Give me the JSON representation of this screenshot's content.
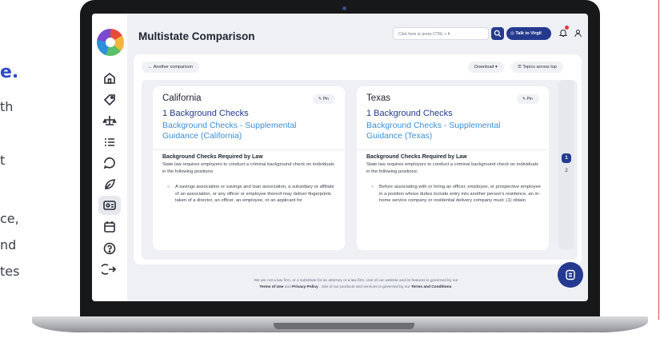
{
  "marketing": {
    "headline_fragment": "e.",
    "lines": [
      "th",
      "t",
      "ce,",
      "nd",
      "tes"
    ]
  },
  "app": {
    "page_title": "Multistate Comparison",
    "search_placeholder": "Click here or press CTRL + K",
    "talk_button_label": "Talk to Virgil"
  },
  "toolbar": {
    "back_label": "← Another comparison",
    "download_label": "Download ▾",
    "topics_label": "Topics across top"
  },
  "cards": [
    {
      "state": "California",
      "pin_label": "Pin",
      "topic": "1 Background Checks",
      "subtopic": "Background Checks - Supplemental Guidance (California)",
      "section_heading": "Background Checks Required by Law",
      "section_text": "State law requires employers to conduct a criminal background check on individuals in the following positions:",
      "bullet": "A savings association or savings and loan association, a subsidiary or affiliate of an association, or any officer or employee thereof may deliver fingerprints taken of a director, an officer, an employee, or an applicant for"
    },
    {
      "state": "Texas",
      "pin_label": "Pin",
      "topic": "1 Background Checks",
      "subtopic": "Background Checks - Supplemental Guidance (Texas)",
      "section_heading": "Background Checks Required by Law",
      "section_text": "State law requires employers to conduct a criminal background check on individuals in the following positions:",
      "bullet": "Before associating with or hiring an officer, employee, or prospective employee in a position whose duties include entry into another person's residence, an in-home service company or residential delivery company must: (1) obtain"
    }
  ],
  "pagination": {
    "current": "1",
    "next": "2"
  },
  "footer": {
    "line1": "We are not a law firm, or a substitute for an attorney or a law firm. Use of our website and its features is governed by our",
    "terms_of_use": "Terms of Use",
    "and1": "and",
    "privacy_policy": "Privacy Policy",
    "line2_mid": ". Use of our products and services is governed by our",
    "terms_conditions": "Terms and Conditions",
    "period": "."
  },
  "colors": {
    "brand_navy": "#253a8f",
    "link_blue": "#3b8fd6",
    "notification_red": "#e03b3b"
  },
  "icons": [
    "home-icon",
    "tag-icon",
    "scale-icon",
    "list-icon",
    "chat-bubble-icon",
    "leaf-icon",
    "id-card-icon",
    "calendar-icon",
    "help-icon",
    "logout-icon",
    "search-icon",
    "virgil-icon",
    "bell-icon",
    "user-icon",
    "chat-assistant-icon"
  ]
}
